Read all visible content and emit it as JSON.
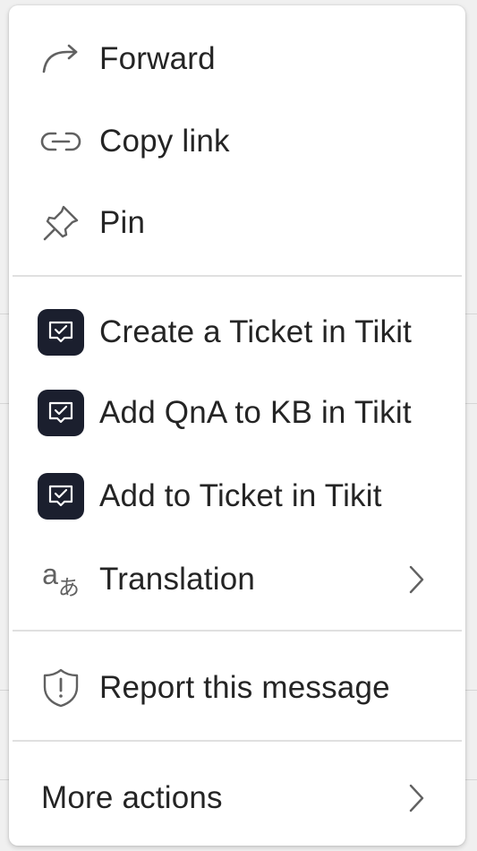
{
  "menu": {
    "group1": [
      {
        "label": "Forward",
        "icon": "forward-arrow-icon"
      },
      {
        "label": "Copy link",
        "icon": "link-icon"
      },
      {
        "label": "Pin",
        "icon": "pin-icon"
      }
    ],
    "group2": [
      {
        "label": "Create a Ticket in Tikit",
        "icon": "tikit-app-icon"
      },
      {
        "label": "Add QnA to KB in Tikit",
        "icon": "tikit-app-icon"
      },
      {
        "label": "Add to Ticket in Tikit",
        "icon": "tikit-app-icon"
      },
      {
        "label": "Translation",
        "icon": "translation-icon",
        "submenu": true
      }
    ],
    "group3": [
      {
        "label": "Report this message",
        "icon": "shield-warning-icon"
      }
    ],
    "group4": [
      {
        "label": "More actions",
        "submenu": true
      }
    ]
  },
  "colors": {
    "text": "#242424",
    "icon": "#616161",
    "tikit_bg": "#1b1f2e",
    "divider": "#e0e0e0",
    "menu_bg": "#ffffff"
  }
}
